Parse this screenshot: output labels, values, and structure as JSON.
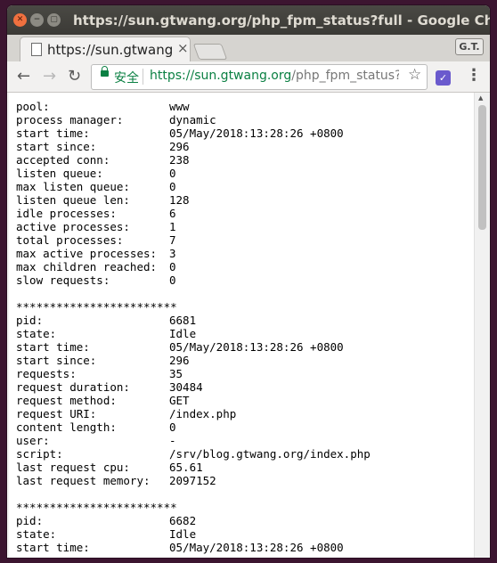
{
  "window": {
    "title": "https://sun.gtwang.org/php_fpm_status?full - Google Chrome"
  },
  "tab": {
    "label": "https://sun.gtwang",
    "close": "×"
  },
  "profile": {
    "label": "G.T."
  },
  "omnibox": {
    "secure_label": "安全",
    "scheme": "https://",
    "host": "sun.gtwang.org",
    "path": "/php_fpm_status?..."
  },
  "pool_summary": [
    {
      "key": "pool:",
      "value": "www"
    },
    {
      "key": "process manager:",
      "value": "dynamic"
    },
    {
      "key": "start time:",
      "value": "05/May/2018:13:28:26 +0800"
    },
    {
      "key": "start since:",
      "value": "296"
    },
    {
      "key": "accepted conn:",
      "value": "238"
    },
    {
      "key": "listen queue:",
      "value": "0"
    },
    {
      "key": "max listen queue:",
      "value": "0"
    },
    {
      "key": "listen queue len:",
      "value": "128"
    },
    {
      "key": "idle processes:",
      "value": "6"
    },
    {
      "key": "active processes:",
      "value": "1"
    },
    {
      "key": "total processes:",
      "value": "7"
    },
    {
      "key": "max active processes:",
      "value": "3"
    },
    {
      "key": "max children reached:",
      "value": "0"
    },
    {
      "key": "slow requests:",
      "value": "0"
    }
  ],
  "separator": "************************",
  "process_1": [
    {
      "key": "pid:",
      "value": "6681"
    },
    {
      "key": "state:",
      "value": "Idle"
    },
    {
      "key": "start time:",
      "value": "05/May/2018:13:28:26 +0800"
    },
    {
      "key": "start since:",
      "value": "296"
    },
    {
      "key": "requests:",
      "value": "35"
    },
    {
      "key": "request duration:",
      "value": "30484"
    },
    {
      "key": "request method:",
      "value": "GET"
    },
    {
      "key": "request URI:",
      "value": "/index.php"
    },
    {
      "key": "content length:",
      "value": "0"
    },
    {
      "key": "user:",
      "value": "-"
    },
    {
      "key": "script:",
      "value": "/srv/blog.gtwang.org/index.php"
    },
    {
      "key": "last request cpu:",
      "value": "65.61"
    },
    {
      "key": "last request memory:",
      "value": "2097152"
    }
  ],
  "process_2": [
    {
      "key": "pid:",
      "value": "6682"
    },
    {
      "key": "state:",
      "value": "Idle"
    },
    {
      "key": "start time:",
      "value": "05/May/2018:13:28:26 +0800"
    }
  ]
}
